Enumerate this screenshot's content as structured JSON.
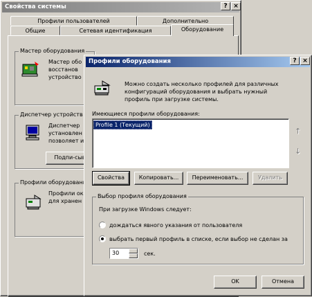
{
  "sysprops": {
    "title": "Свойства системы",
    "help_button": "?",
    "close_button": "×",
    "tabs_row1": [
      "Профили пользователей",
      "Дополнительно"
    ],
    "tabs_row2": [
      "Общие",
      "Сетевая идентификация",
      "Оборудование"
    ],
    "groups": [
      {
        "title": "Мастер оборудования",
        "lines": [
          "Мастер обо",
          "восстанов",
          "устройство"
        ]
      },
      {
        "title": "Диспетчер устройств",
        "lines": [
          "Диспетчер",
          "установлен",
          "позволяет и"
        ],
        "button": "Подпи-сыван"
      },
      {
        "title": "Профили оборудования",
        "lines": [
          "Профили ок",
          "для хранен"
        ]
      }
    ]
  },
  "hwprofiles": {
    "title": "Профили оборудования",
    "help_button": "?",
    "close_button": "×",
    "description": [
      "Можно создать несколько профилей для различных",
      "конфигураций оборудования и выбрать нужный",
      "профиль при загрузке системы."
    ],
    "list_label": "Имеющиеся профили оборудования:",
    "list_items": [
      "Profile 1 (Текущий)"
    ],
    "up_arrow": "↑",
    "down_arrow": "↓",
    "buttons": {
      "properties": "Свойства",
      "copy": "Копировать...",
      "rename": "Переименовать...",
      "delete": "Удалить"
    },
    "selection": {
      "group_title": "Выбор профиля оборудования",
      "label": "При загрузке Windows следует:",
      "option_wait": "дождаться явного указания от пользователя",
      "option_first": "выбрать первый профиль в списке, если выбор не сделан за",
      "seconds_value": "30",
      "seconds_label": "сек."
    },
    "ok": "OK",
    "cancel": "Отмена"
  }
}
